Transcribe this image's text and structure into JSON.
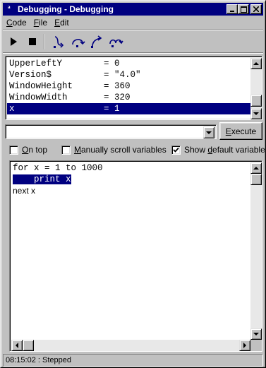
{
  "window": {
    "title": "Debugging - Debugging",
    "icon": "debug-app-icon"
  },
  "title_buttons": [
    "minimize-icon",
    "maximize-icon",
    "close-icon"
  ],
  "menu": {
    "items": [
      {
        "label": "Code",
        "accel": "C",
        "rest": "ode"
      },
      {
        "label": "File",
        "accel": "F",
        "rest": "ile"
      },
      {
        "label": "Edit",
        "accel": "E",
        "rest": "dit"
      }
    ]
  },
  "toolbar": {
    "buttons": [
      "run-icon",
      "stop-icon",
      "step-into-icon",
      "step-over-icon",
      "step-out-icon",
      "animate-icon"
    ]
  },
  "variables": {
    "rows": [
      {
        "name": "UpperLeftY",
        "value": "= 0"
      },
      {
        "name": "Version$",
        "value": "= \"4.0\""
      },
      {
        "name": "WindowHeight",
        "value": "= 360"
      },
      {
        "name": "WindowWidth",
        "value": "= 320"
      },
      {
        "name": "x",
        "value": "= 1",
        "selected": true
      }
    ]
  },
  "command": {
    "value": "",
    "execute_label": "Execute",
    "execute_accel": "E",
    "execute_rest": "xecute"
  },
  "options": {
    "on_top": {
      "accel": "O",
      "rest": "n top",
      "checked": false
    },
    "manual_scroll": {
      "accel": "M",
      "rest": "anually scroll variables",
      "checked": false
    },
    "show_default": {
      "pre": "Show ",
      "accel": "d",
      "rest": "efault variables",
      "checked": true
    }
  },
  "code": {
    "lines": [
      {
        "text": "for x = 1 to 1000"
      },
      {
        "text": "    print x",
        "highlighted": true
      },
      {
        "text": "next x"
      }
    ]
  },
  "status": {
    "text": "08:15:02 : Stepped"
  },
  "colors": {
    "titlebar": "#000080",
    "selection": "#000080",
    "face": "#c0c0c0"
  }
}
